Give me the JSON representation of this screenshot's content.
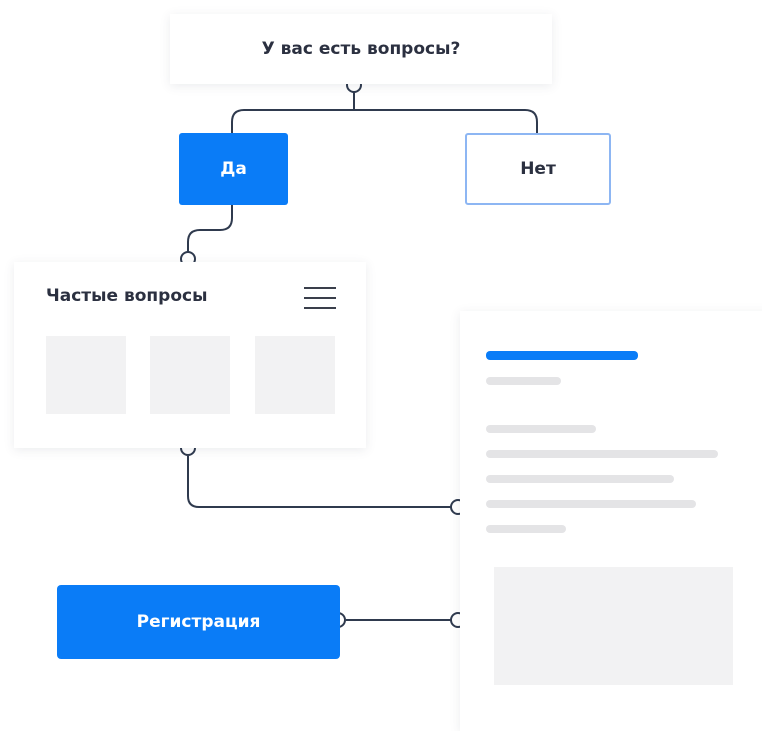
{
  "question": {
    "text": "У вас есть вопросы?"
  },
  "options": {
    "yes_label": "Да",
    "no_label": "Нет"
  },
  "faq": {
    "title": "Частые вопросы"
  },
  "register": {
    "label": "Регистрация"
  },
  "colors": {
    "accent": "#0a7cf7",
    "connector": "#2f3a4e",
    "placeholder": "#f2f2f3",
    "no_border": "#8db6f3"
  }
}
